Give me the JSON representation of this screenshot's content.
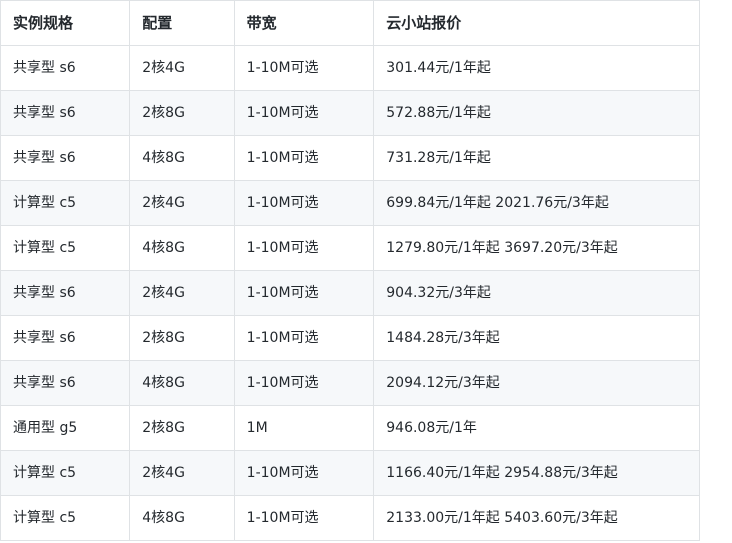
{
  "table": {
    "headers": [
      "实例规格",
      "配置",
      "带宽",
      "云小站报价"
    ],
    "rows": [
      [
        "共享型 s6",
        "2核4G",
        "1-10M可选",
        "301.44元/1年起"
      ],
      [
        "共享型 s6",
        "2核8G",
        "1-10M可选",
        "572.88元/1年起"
      ],
      [
        "共享型 s6",
        "4核8G",
        "1-10M可选",
        "731.28元/1年起"
      ],
      [
        "计算型 c5",
        "2核4G",
        "1-10M可选",
        "699.84元/1年起 2021.76元/3年起"
      ],
      [
        "计算型 c5",
        "4核8G",
        "1-10M可选",
        "1279.80元/1年起 3697.20元/3年起"
      ],
      [
        "共享型 s6",
        "2核4G",
        "1-10M可选",
        "904.32元/3年起"
      ],
      [
        "共享型 s6",
        "2核8G",
        "1-10M可选",
        "1484.28元/3年起"
      ],
      [
        "共享型 s6",
        "4核8G",
        "1-10M可选",
        "2094.12元/3年起"
      ],
      [
        "通用型 g5",
        "2核8G",
        "1M",
        "946.08元/1年"
      ],
      [
        "计算型 c5",
        "2核4G",
        "1-10M可选",
        "1166.40元/1年起 2954.88元/3年起"
      ],
      [
        "计算型 c5",
        "4核8G",
        "1-10M可选",
        "2133.00元/1年起 5403.60元/3年起"
      ]
    ]
  },
  "colors": {
    "border": "#dfe2e5",
    "stripe": "#f6f8fa",
    "text": "#24292e"
  }
}
